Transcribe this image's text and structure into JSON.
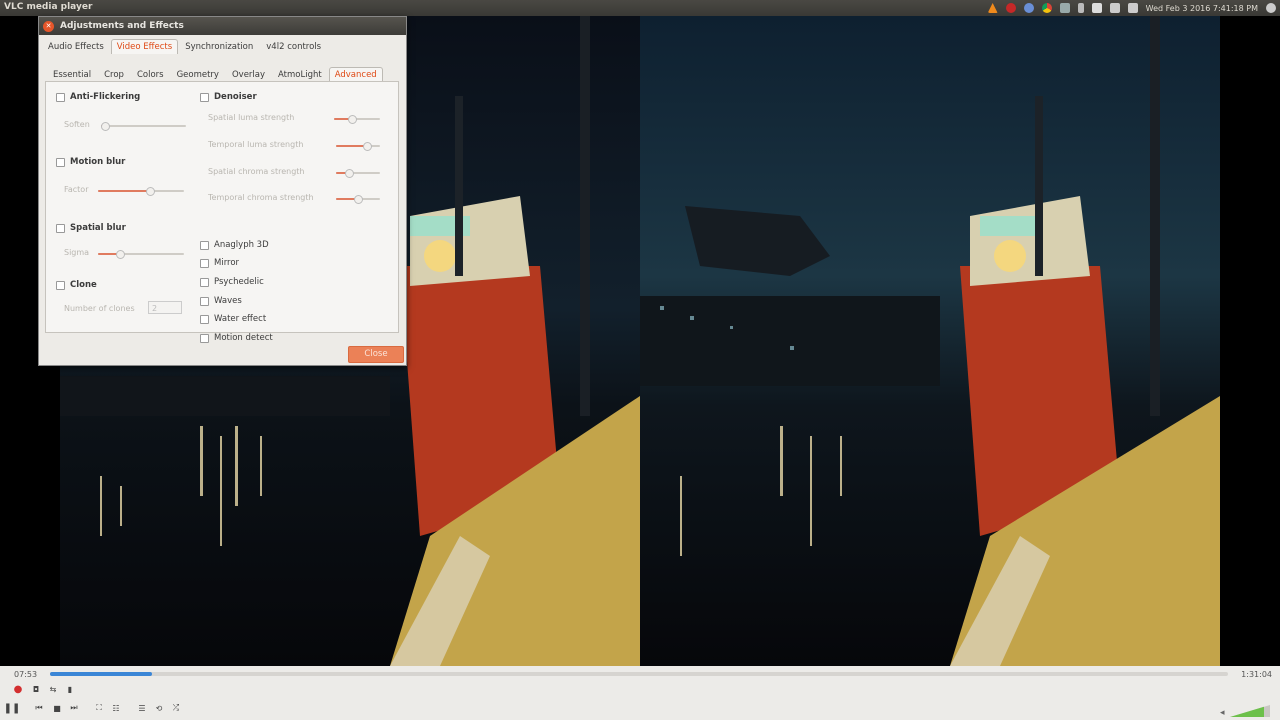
{
  "topbar": {
    "app_title": "VLC media player",
    "clock": "Wed Feb  3 2016  7:41:18 PM"
  },
  "dialog": {
    "title": "Adjustments and Effects",
    "main_tabs": [
      "Audio Effects",
      "Video Effects",
      "Synchronization",
      "v4l2 controls"
    ],
    "selected_main_tab": "Video Effects",
    "sub_tabs": [
      "Essential",
      "Crop",
      "Colors",
      "Geometry",
      "Overlay",
      "AtmoLight",
      "Advanced"
    ],
    "selected_sub_tab": "Advanced",
    "anti_flickering": {
      "label": "Anti-Flickering",
      "checked": false,
      "param_label": "Soften",
      "value": 0.05
    },
    "motion_blur": {
      "label": "Motion blur",
      "checked": false,
      "param_label": "Factor",
      "value": 0.6
    },
    "spatial_blur": {
      "label": "Spatial blur",
      "checked": false,
      "param_label": "Sigma",
      "value": 0.25
    },
    "clone": {
      "label": "Clone",
      "checked": false,
      "param_label": "Number of clones",
      "value": "2"
    },
    "denoiser": {
      "label": "Denoiser",
      "checked": false,
      "params": [
        {
          "label": "Spatial luma strength",
          "value": 0.4
        },
        {
          "label": "Temporal luma strength",
          "value": 0.7
        },
        {
          "label": "Spatial chroma strength",
          "value": 0.3
        },
        {
          "label": "Temporal chroma strength",
          "value": 0.5
        }
      ]
    },
    "filters": [
      "Anaglyph 3D",
      "Mirror",
      "Psychedelic",
      "Waves",
      "Water effect",
      "Motion detect"
    ],
    "close_label": "Close"
  },
  "player": {
    "time_current": "07:53",
    "time_total": "1:31:04",
    "progress": 0.087,
    "volume": 0.85
  }
}
